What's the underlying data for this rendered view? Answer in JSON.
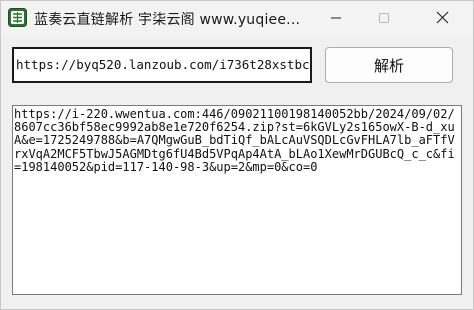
{
  "window": {
    "title": "蓝奏云直链解析 宇柒云阁 www.yuqiee...",
    "icon": "app-logo-icon"
  },
  "controls": {
    "minimize_icon": "minimize-icon",
    "maximize_icon": "maximize-icon",
    "close_icon": "close-icon"
  },
  "input": {
    "url_value": "https://byq520.lanzoub.com/i736t28xstbc"
  },
  "parse_button": {
    "label": "解析"
  },
  "result": {
    "text": "https://i-220.wwentua.com:446/09021100198140052bb/2024/09/02/8607cc36bf58ec9992ab8e1e720f6254.zip?st=6kGVLy2s165owX-B-d_xuA&e=1725249788&b=A7QMgwGuB_bdTiQf_bALcAuVSQDLcGvFHLA7lb_aFTfVrxVqA2MCF5TbwJ5AGMDtg6fU4Bd5VPqAp4AtA_bLAo1XewMrDGUBcQ_c_c&fi=198140052&pid=117-140-98-3&up=2&mp=0&co=0"
  },
  "colors": {
    "titlebar_bg": "#f3f3f3",
    "window_bg": "#f0f0f0",
    "icon_accent": "#3a7a3a"
  }
}
